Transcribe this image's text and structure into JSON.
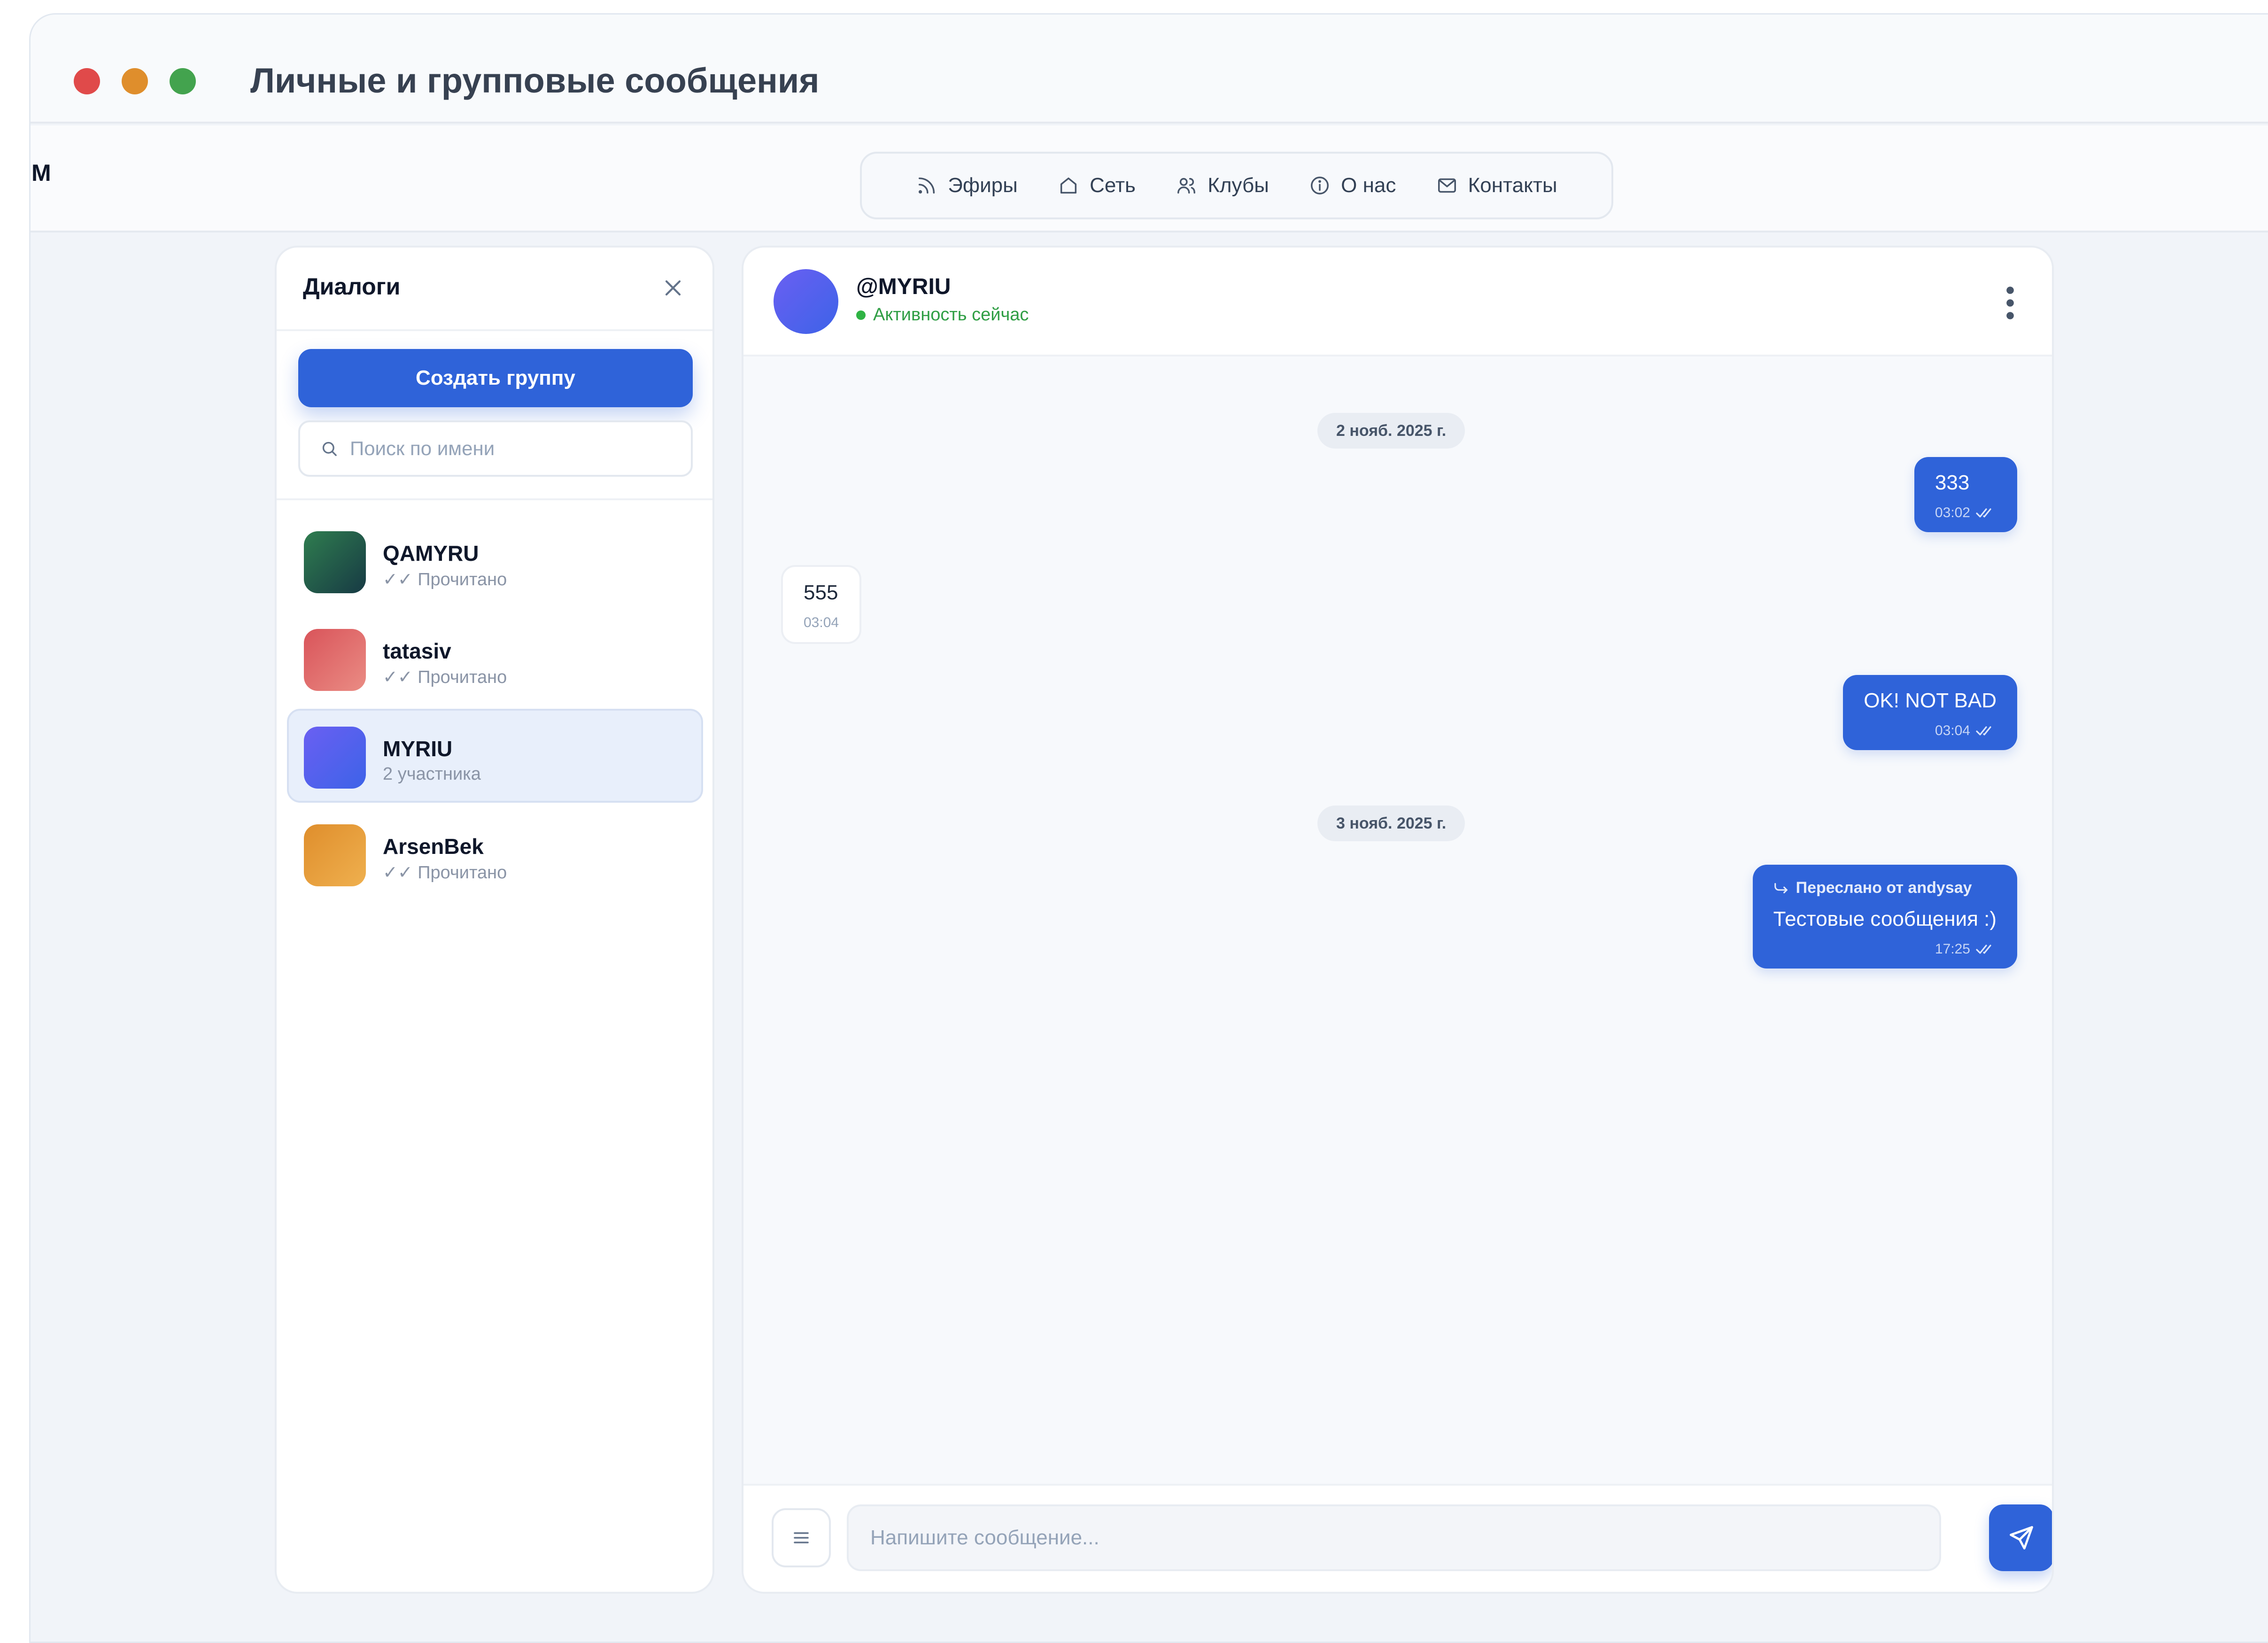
{
  "window": {
    "title": "Личные и групповые сообщения"
  },
  "navbar": {
    "logo_letter": "M",
    "items": [
      {
        "label": "Эфиры",
        "icon": "rss-icon"
      },
      {
        "label": "Сеть",
        "icon": "home-icon"
      },
      {
        "label": "Клубы",
        "icon": "users-icon"
      },
      {
        "label": "О нас",
        "icon": "info-icon"
      },
      {
        "label": "Контакты",
        "icon": "mail-icon"
      }
    ]
  },
  "sidebar": {
    "title": "Диалоги",
    "create_group_label": "Создать группу",
    "search_placeholder": "Поиск по имени",
    "dialogs": [
      {
        "name": "QAMYRU",
        "subtitle": "✓✓ Прочитано",
        "avatar_colors": [
          "#2f7d4f",
          "#173a44"
        ],
        "active": false
      },
      {
        "name": "tatasiv",
        "subtitle": "✓✓ Прочитано",
        "avatar_colors": [
          "#d9545a",
          "#ea8c84"
        ],
        "active": false
      },
      {
        "name": "MYRIU",
        "subtitle": "2 участника",
        "avatar_colors": [
          "#6a5ff2",
          "#3d63e8"
        ],
        "active": true
      },
      {
        "name": "ArsenBek",
        "subtitle": "✓✓ Прочитано",
        "avatar_colors": [
          "#df8e2c",
          "#efb04f"
        ],
        "active": false
      }
    ]
  },
  "chat": {
    "name": "@MYRIU",
    "status": "Активность сейчас",
    "dates": [
      "2 нояб. 2025 г.",
      "3 нояб. 2025 г."
    ],
    "messages": [
      {
        "text": "333",
        "time": "03:02",
        "direction": "out",
        "read": true
      },
      {
        "text": "555",
        "time": "03:04",
        "direction": "in"
      },
      {
        "text": "OK! NOT BAD",
        "time": "03:04",
        "direction": "out",
        "read": true
      },
      {
        "forwarded_from": "Переслано от andysay",
        "text": "Тестовые сообщения :)",
        "time": "17:25",
        "direction": "out",
        "read": true
      }
    ],
    "composer_placeholder": "Напишите сообщение..."
  },
  "colors": {
    "accent": "#2f63d9",
    "online": "#2fb344",
    "background": "#f1f4f9"
  }
}
